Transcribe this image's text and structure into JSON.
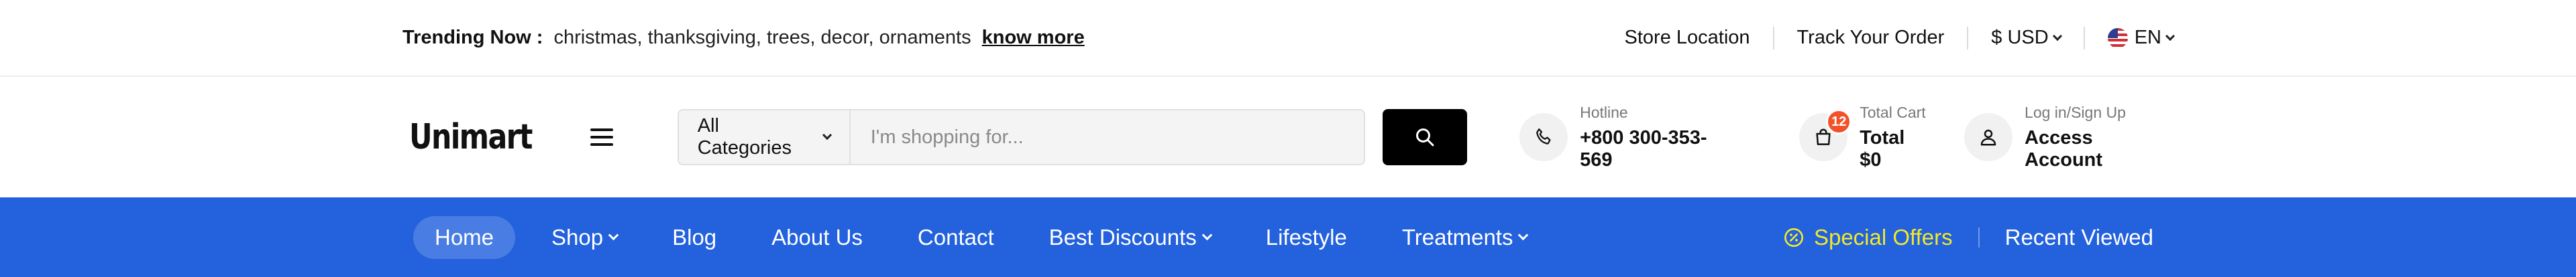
{
  "topbar": {
    "trending_label": "Trending Now :",
    "trending_tags": "christmas, thanksgiving, trees, decor, ornaments",
    "know_more": "know more",
    "store_location": "Store Location",
    "track_order": "Track Your Order",
    "currency": "$ USD",
    "language": "EN"
  },
  "header": {
    "logo_text": "Unimart",
    "search": {
      "category": "All Categories",
      "placeholder": "I'm shopping for..."
    },
    "hotline": {
      "label": "Hotline",
      "value": "+800 300-353-569"
    },
    "cart": {
      "badge": "12",
      "label": "Total Cart",
      "value": "Total $0"
    },
    "account": {
      "label": "Log in/Sign Up",
      "value": "Access Account"
    }
  },
  "nav": {
    "items": [
      {
        "label": "Home"
      },
      {
        "label": "Shop"
      },
      {
        "label": "Blog"
      },
      {
        "label": "About Us"
      },
      {
        "label": "Contact"
      },
      {
        "label": "Best Discounts"
      },
      {
        "label": "Lifestyle"
      },
      {
        "label": "Treatments"
      }
    ],
    "special_offers": "Special Offers",
    "recent_viewed": "Recent Viewed"
  },
  "colors": {
    "brand_blue": "#2361dd",
    "special_yellow": "#f0ea2a",
    "badge_orange": "#f2522a"
  },
  "icons": [
    "menu-icon",
    "search-icon",
    "phone-icon",
    "shopping-bag-icon",
    "user-icon",
    "discount-icon",
    "us-flag-icon",
    "chevron-down-icon"
  ]
}
